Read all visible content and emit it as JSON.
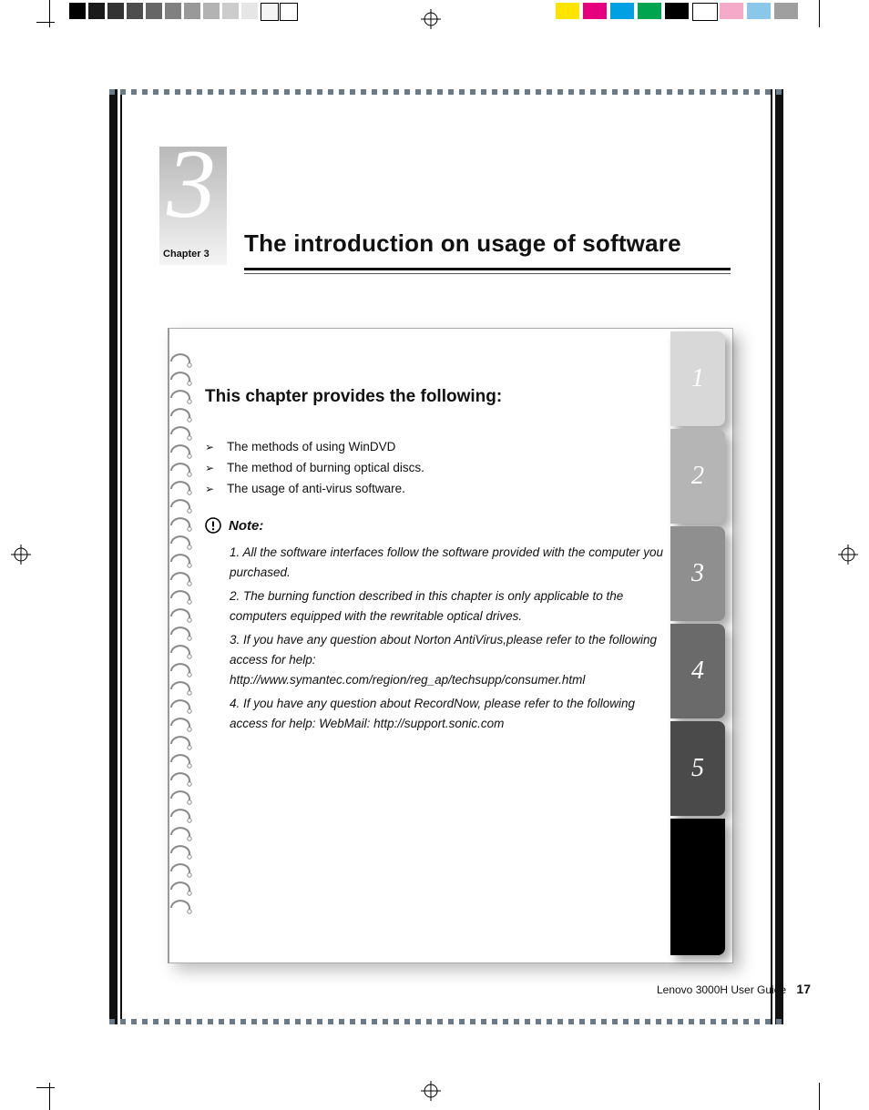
{
  "printer_marks": {
    "gray_shades": [
      "#000000",
      "#1a1a1a",
      "#333333",
      "#4d4d4d",
      "#666666",
      "#808080",
      "#999999",
      "#b3b3b3",
      "#cccccc",
      "#e6e6e6",
      "#f5f5f5",
      "#ffffff"
    ],
    "color_swatches": [
      "#ffe400",
      "#e6007e",
      "#00a0e3",
      "#00a54f",
      "#000000",
      "#ffffff",
      "#f6aaca",
      "#8bc7e9",
      "#9f9f9f"
    ]
  },
  "chapter": {
    "number": "3",
    "label": "Chapter 3",
    "title": "The introduction on usage of software"
  },
  "section_title": "This chapter provides the following:",
  "bullets": [
    "The methods of using WinDVD",
    "The method of burning optical discs.",
    "The usage of anti-virus software."
  ],
  "note_label": "Note:",
  "notes": [
    "1. All the software interfaces follow the software provided with the computer you purchased.",
    "2. The burning function described in this chapter is only applicable to the computers equipped with the rewritable optical drives.",
    "3. If you have any question about Norton AntiVirus,please refer to the following access for help: http://www.symantec.com/region/reg_ap/techsupp/consumer.html",
    "4. If you have any question about RecordNow, please refer to the following access for help: WebMail: http://support.sonic.com"
  ],
  "tabs": {
    "items": [
      {
        "label": "1",
        "bg": "#d8d8d8"
      },
      {
        "label": "2",
        "bg": "#b5b5b5"
      },
      {
        "label": "3",
        "bg": "#8f8f8f"
      },
      {
        "label": "4",
        "bg": "#6a6a6a"
      },
      {
        "label": "5",
        "bg": "#4a4a4a"
      }
    ],
    "rest_height": 150
  },
  "footer": {
    "guide": "Lenovo 3000H User Guide",
    "page": "17"
  }
}
